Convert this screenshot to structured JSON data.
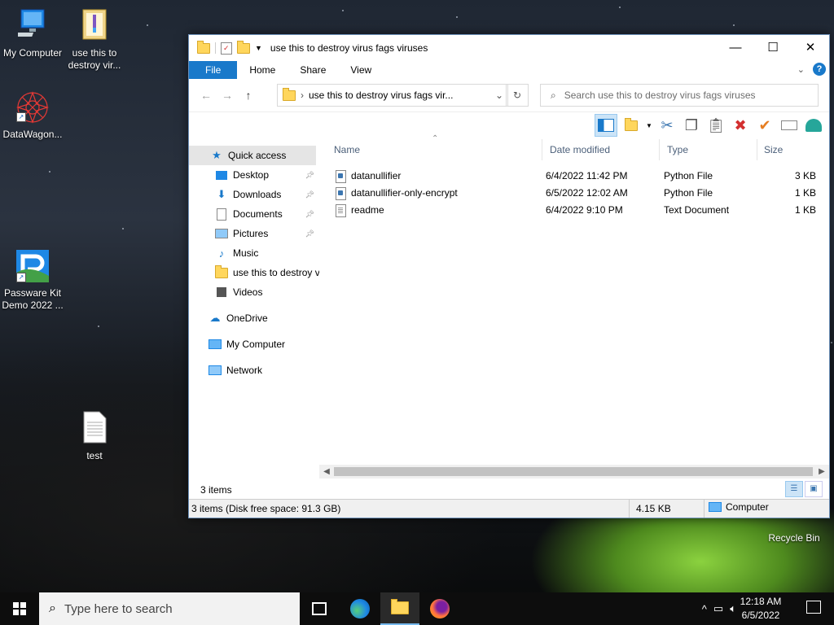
{
  "desktop": {
    "icons": [
      {
        "label": "My Computer"
      },
      {
        "label": "use this to destroy vir..."
      },
      {
        "label": "DataWagon..."
      },
      {
        "label": "Passware Kit Demo 2022 ..."
      },
      {
        "label": "test"
      },
      {
        "label": "Recycle Bin"
      }
    ]
  },
  "window": {
    "title": "use this to destroy virus fags viruses",
    "controls": {
      "minimize": "—",
      "maximize": "☐",
      "close": "✕"
    },
    "ribbon_tabs": [
      "File",
      "Home",
      "Share",
      "View"
    ],
    "address": "use this to destroy virus fags vir...",
    "search_placeholder": "Search use this to destroy virus fags viruses",
    "nav": {
      "quick_access": "Quick access",
      "quick_items": [
        "Desktop",
        "Downloads",
        "Documents",
        "Pictures",
        "Music",
        "use this to destroy v",
        "Videos"
      ],
      "onedrive": "OneDrive",
      "my_computer": "My Computer",
      "network": "Network"
    },
    "columns": {
      "name": "Name",
      "date": "Date modified",
      "type": "Type",
      "size": "Size"
    },
    "files": [
      {
        "name": "datanullifier",
        "date": "6/4/2022 11:42 PM",
        "type": "Python File",
        "size": "3 KB",
        "icon": "python-file-icon"
      },
      {
        "name": "datanullifier-only-encrypt",
        "date": "6/5/2022 12:02 AM",
        "type": "Python File",
        "size": "1 KB",
        "icon": "python-file-icon"
      },
      {
        "name": "readme",
        "date": "6/4/2022 9:10 PM",
        "type": "Text Document",
        "size": "1 KB",
        "icon": "text-file-icon"
      }
    ],
    "status_items": "3 items",
    "status_bar": {
      "summary": "3 items (Disk free space: 91.3 GB)",
      "size": "4.15 KB",
      "location": "Computer"
    }
  },
  "taskbar": {
    "search_placeholder": "Type here to search",
    "time": "12:18 AM",
    "date": "6/5/2022"
  },
  "colors": {
    "accent": "#1979ca",
    "delete": "#d32f2f",
    "check": "#e67e22"
  }
}
